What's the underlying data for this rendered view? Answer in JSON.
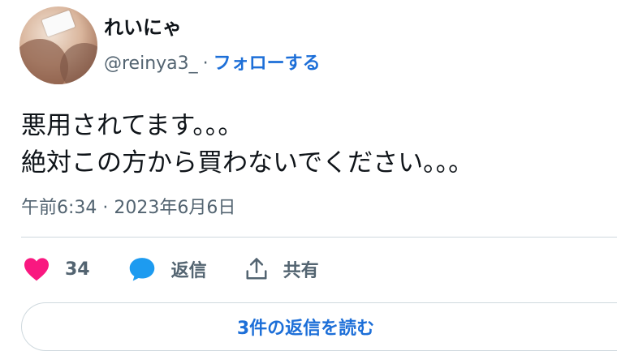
{
  "author": {
    "display_name": "れいにゃ",
    "handle": "@reinya3_",
    "separator": "·",
    "follow_label": "フォローする"
  },
  "tweet": {
    "line1": "悪用されてます。。。",
    "line2": "絶対この方から買わないでください。。。",
    "timestamp": "午前6:34 · 2023年6月6日"
  },
  "actions": {
    "likes_count": "34",
    "reply_label": "返信",
    "share_label": "共有"
  },
  "replies_button": {
    "label": "3件の返信を読む"
  },
  "colors": {
    "like": "#f91880",
    "reply": "#1d9bf0",
    "link": "#1d6fd8",
    "muted": "#536471",
    "divider": "#cfd9de"
  },
  "icons": {
    "like": "heart-icon",
    "reply": "speech-bubble-icon",
    "share": "share-upload-icon"
  }
}
